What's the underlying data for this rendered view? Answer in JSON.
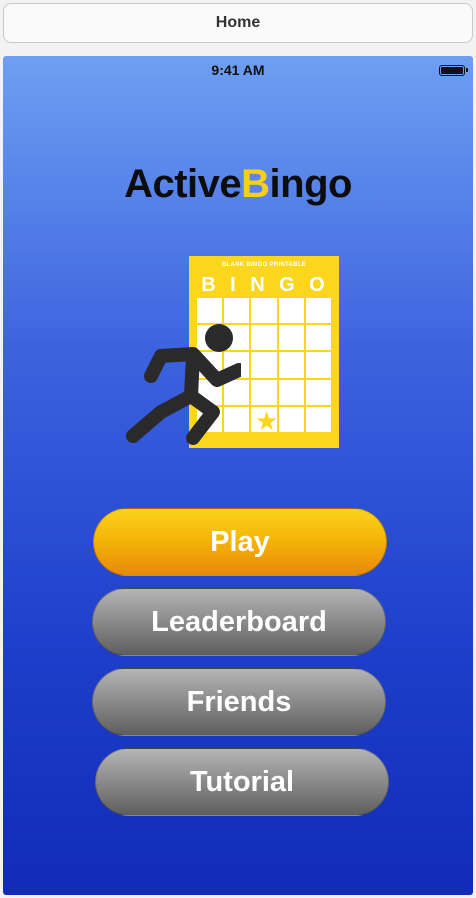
{
  "nav": {
    "title": "Home"
  },
  "status_bar": {
    "time": "9:41 AM",
    "battery_icon": "battery-full-icon"
  },
  "logo": {
    "part1": "Active",
    "accent": "B",
    "part2": "ingo",
    "accent_color": "#f7cf1b"
  },
  "hero": {
    "card_header": "BLANK BINGO PRINTABLE",
    "card_letters": [
      "B",
      "I",
      "N",
      "G",
      "O"
    ],
    "runner_icon": "running-person-icon",
    "card_color": "#fcd61d"
  },
  "buttons": {
    "play": "Play",
    "leaderboard": "Leaderboard",
    "friends": "Friends",
    "tutorial": "Tutorial"
  },
  "colors": {
    "background_top": "#6e9ff2",
    "background_bottom": "#102bb8",
    "play_button": "#f5b607",
    "secondary_button": "#8a8a8a"
  }
}
